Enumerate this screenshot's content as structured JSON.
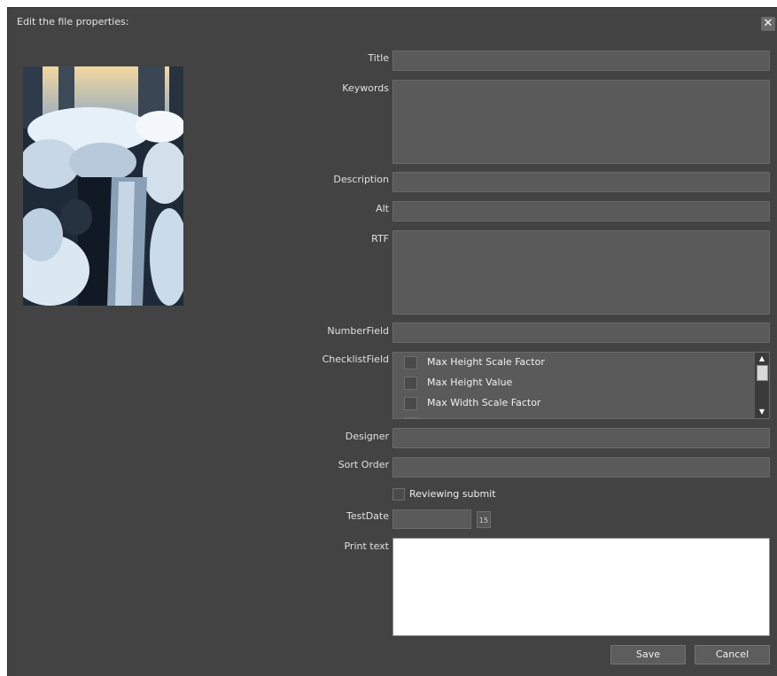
{
  "dialog": {
    "title": "Edit the file properties:",
    "close_glyph": "✕"
  },
  "form": {
    "title_label": "Title",
    "keywords_label": "Keywords",
    "description_label": "Description",
    "alt_label": "Alt",
    "rtf_label": "RTF",
    "numberfield_label": "NumberField",
    "checklist_label": "ChecklistField",
    "checklist_items": [
      "Max Height Scale Factor",
      "Max Height Value",
      "Max Width Scale Factor"
    ],
    "designer_label": "Designer",
    "sort_order_label": "Sort Order",
    "reviewing_label": "Reviewing submit",
    "testdate_label": "TestDate",
    "print_text_label": "Print text"
  },
  "buttons": {
    "save": "Save",
    "cancel": "Cancel"
  },
  "icons": {
    "close": "close-icon",
    "calendar": "calendar-icon",
    "scroll_up": "scroll-up-icon",
    "scroll_down": "scroll-down-icon"
  },
  "colors": {
    "dialog_bg": "#434343",
    "field_bg": "#5a5a5a",
    "button_bg": "#5d5d5d"
  }
}
